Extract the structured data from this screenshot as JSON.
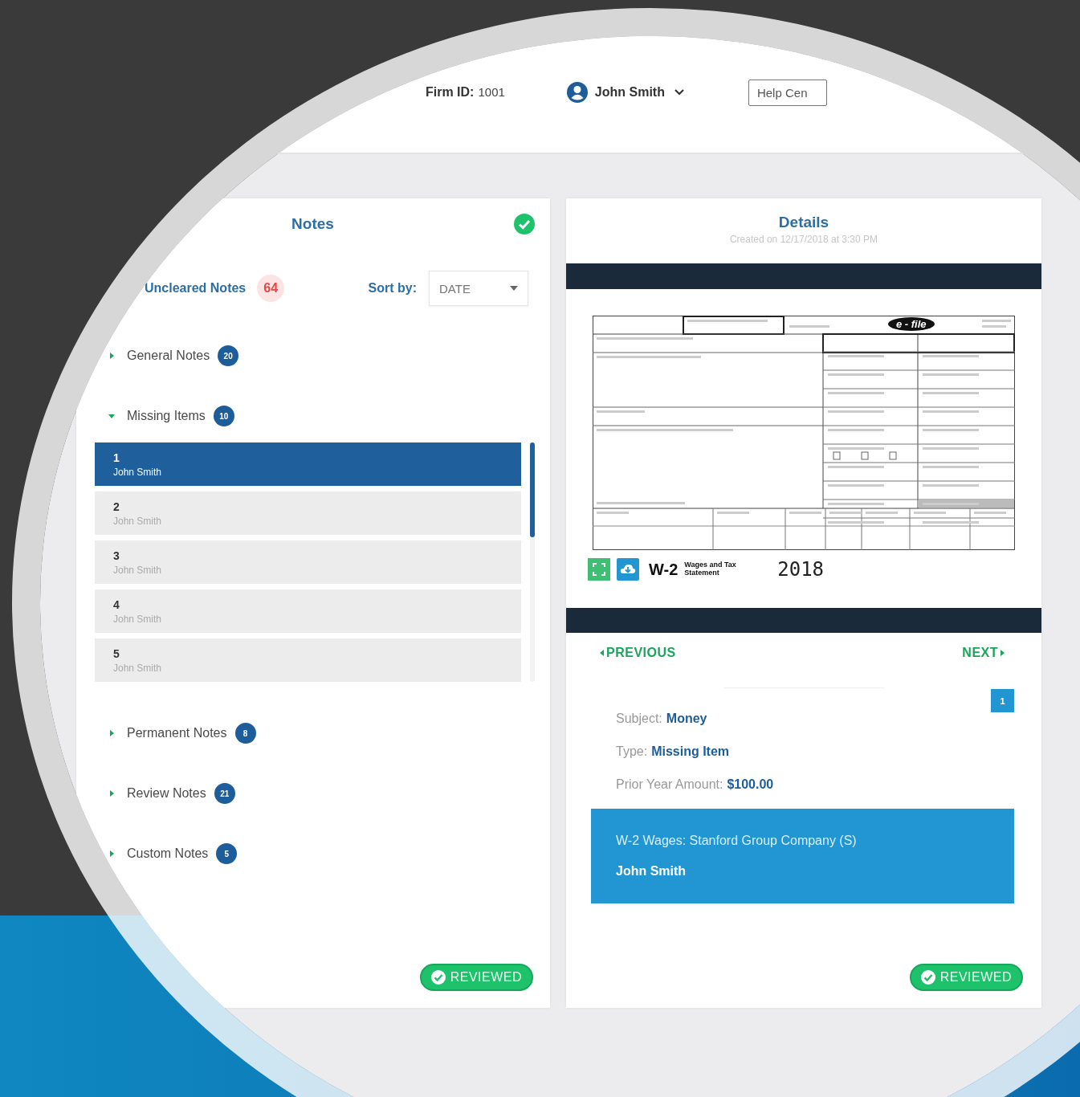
{
  "header": {
    "firm_id_label": "Firm ID:",
    "firm_id": "1001",
    "user": "John Smith",
    "help_button": "Help Cen"
  },
  "notes": {
    "title": "Notes",
    "uncleared_label": "Uncleared Notes",
    "uncleared_count": "64",
    "sort_label": "Sort by:",
    "sort_value": "DATE",
    "groups": [
      {
        "label": "General Notes",
        "count": "20",
        "expanded": false
      },
      {
        "label": "Missing Items",
        "count": "10",
        "expanded": true,
        "items": [
          {
            "number": "1",
            "name": "John Smith",
            "selected": true
          },
          {
            "number": "2",
            "name": "John Smith",
            "selected": false
          },
          {
            "number": "3",
            "name": "John Smith",
            "selected": false
          },
          {
            "number": "4",
            "name": "John Smith",
            "selected": false
          },
          {
            "number": "5",
            "name": "John Smith",
            "selected": false
          }
        ]
      },
      {
        "label": "Permanent Notes",
        "count": "8",
        "expanded": false
      },
      {
        "label": "Review Notes",
        "count": "21",
        "expanded": false
      },
      {
        "label": "Custom Notes",
        "count": "5",
        "expanded": false
      }
    ],
    "reviewed_button": "REVIEWED"
  },
  "details": {
    "title": "Details",
    "subtitle": "Created on 12/17/2018 at 3:30 PM",
    "document": {
      "efile": "e - file",
      "form": "W-2",
      "form_title": "Wages and Tax Statement",
      "year": "2018"
    },
    "previous": "PREVIOUS",
    "next": "NEXT",
    "count": "1",
    "fields": [
      {
        "label": "Subject:",
        "value": "Money"
      },
      {
        "label": "Type:",
        "value": "Missing Item"
      },
      {
        "label": "Prior Year Amount:",
        "value": "$100.00"
      }
    ],
    "wage_line": "W-2 Wages: Stanford Group Company (S)",
    "wage_owner": "John Smith",
    "reviewed_button": "REVIEWED"
  }
}
